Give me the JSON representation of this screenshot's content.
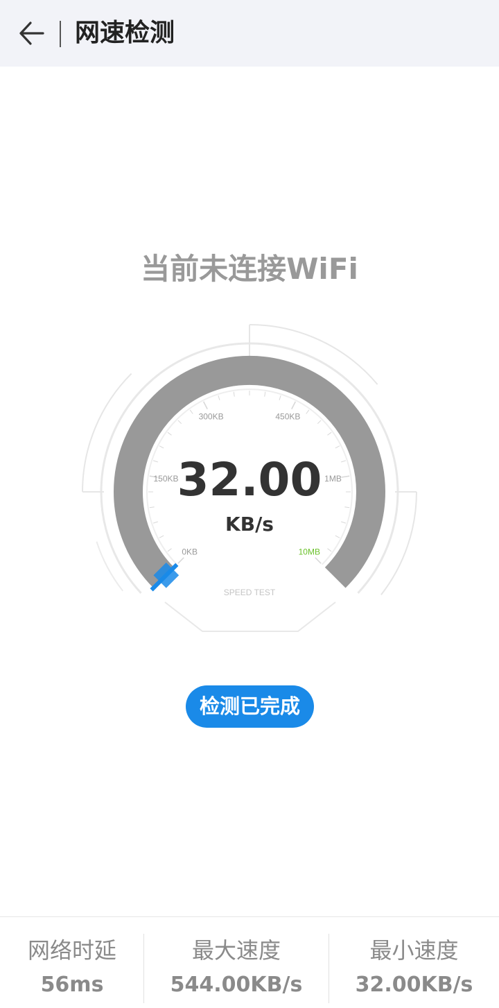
{
  "header": {
    "title": "网速检测"
  },
  "status": {
    "wifi_message": "当前未连接WiFi"
  },
  "gauge": {
    "value": "32.00",
    "unit": "KB/s",
    "caption": "SPEED TEST",
    "scale": [
      {
        "label": "0KB",
        "fraction": 0
      },
      {
        "label": "150KB",
        "fraction": 0.2
      },
      {
        "label": "300KB",
        "fraction": 0.4
      },
      {
        "label": "450KB",
        "fraction": 0.6
      },
      {
        "label": "1MB",
        "fraction": 0.8
      },
      {
        "label": "10MB",
        "fraction": 1
      }
    ],
    "needle_fraction": 0,
    "colors": {
      "arc": "#999999",
      "needle": "#1a8ae8",
      "max_label": "#6ac12a"
    }
  },
  "action": {
    "label": "检测已完成",
    "color": "#1a8ae8"
  },
  "stats": [
    {
      "label": "网络时延",
      "value": "56ms"
    },
    {
      "label": "最大速度",
      "value": "544.00KB/s"
    },
    {
      "label": "最小速度",
      "value": "32.00KB/s"
    }
  ]
}
